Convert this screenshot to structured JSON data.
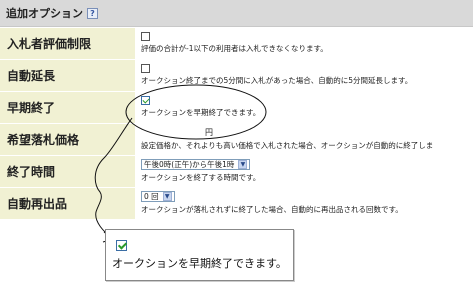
{
  "header": {
    "title": "追加オプション",
    "help_icon": "?"
  },
  "rows": [
    {
      "label": "入札者評価制限",
      "checked": false,
      "desc": "評価の合計が-1以下の利用者は入札できなくなります。"
    },
    {
      "label": "自動延長",
      "checked": false,
      "desc": "オークション終了までの5分間に入札があった場合、自動的に5分間延長します。"
    },
    {
      "label": "早期終了",
      "checked": true,
      "desc": "オークションを早期終了できます。"
    },
    {
      "label": "希望落札価格",
      "unit": "円",
      "desc": "設定価格か、それよりも高い価格で入札された場合、オークションが自動的に終了しま"
    },
    {
      "label": "終了時間",
      "select_value": "午後0時(正午)から午後1時",
      "desc": "オークションを終了する時間です。"
    },
    {
      "label": "自動再出品",
      "select_value": "0 回",
      "desc": "オークションが落札されずに終了した場合、自動的に再出品される回数です。"
    }
  ],
  "callout": {
    "checked": true,
    "text": "オークションを早期終了できます。"
  },
  "colors": {
    "header_bg": "#d9d9d9",
    "label_bg": "#f1f1d3",
    "check_green": "#2a9a2a"
  }
}
